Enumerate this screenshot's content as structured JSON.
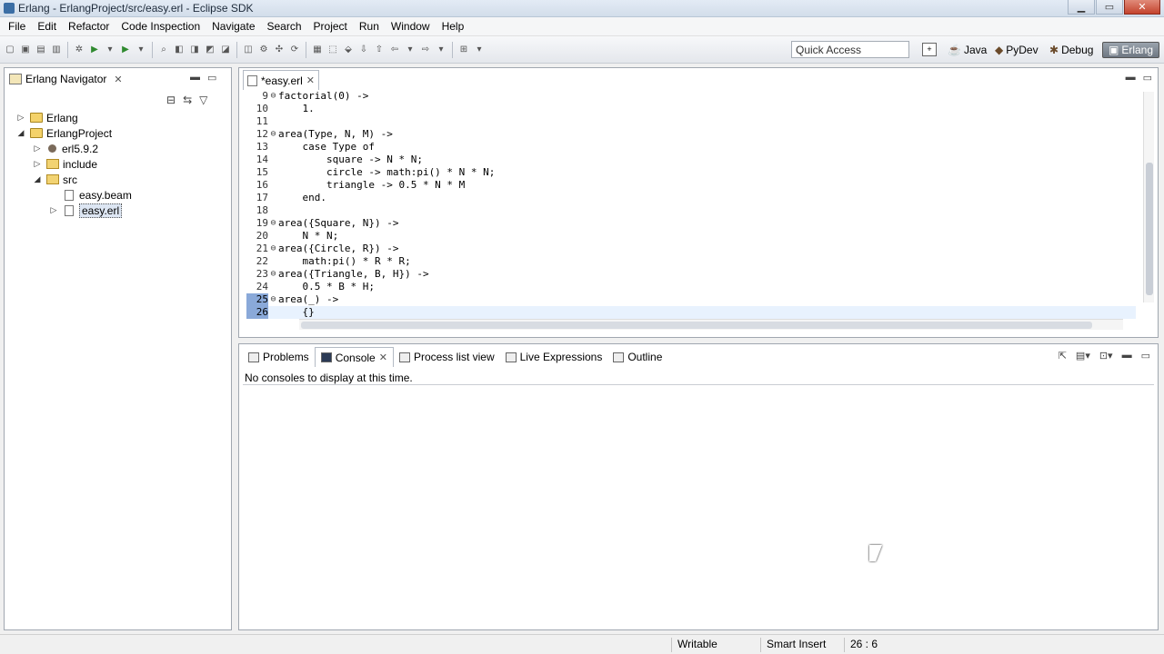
{
  "window": {
    "title": "Erlang - ErlangProject/src/easy.erl - Eclipse SDK"
  },
  "menu": [
    "File",
    "Edit",
    "Refactor",
    "Code Inspection",
    "Navigate",
    "Search",
    "Project",
    "Run",
    "Window",
    "Help"
  ],
  "toolbar": {
    "quick_access": "Quick Access",
    "perspectives": [
      "Java",
      "PyDev",
      "Debug",
      "Erlang"
    ],
    "active_perspective": "Erlang"
  },
  "navigator": {
    "title": "Erlang Navigator",
    "tree": [
      {
        "label": "Erlang",
        "arrow": "▷",
        "icon": "project-icon",
        "depth": 0
      },
      {
        "label": "ErlangProject",
        "arrow": "◢",
        "icon": "project-icon",
        "depth": 0
      },
      {
        "label": "erl5.9.2",
        "arrow": "▷",
        "icon": "library-icon",
        "depth": 1
      },
      {
        "label": "include",
        "arrow": "▷",
        "icon": "folder-icon",
        "depth": 1
      },
      {
        "label": "src",
        "arrow": "◢",
        "icon": "folder-icon",
        "depth": 1
      },
      {
        "label": "easy.beam",
        "arrow": "",
        "icon": "file-icon",
        "depth": 2
      },
      {
        "label": "easy.erl",
        "arrow": "▷",
        "icon": "file-icon",
        "depth": 2,
        "selected": true
      }
    ]
  },
  "editor": {
    "tab_label": "*easy.erl",
    "lines": [
      {
        "n": "9",
        "fold": "⊖",
        "text": "factorial(0) ->"
      },
      {
        "n": "10",
        "fold": "",
        "text": "    1."
      },
      {
        "n": "11",
        "fold": "",
        "text": ""
      },
      {
        "n": "12",
        "fold": "⊖",
        "text": "area(Type, N, M) ->"
      },
      {
        "n": "13",
        "fold": "",
        "text": "    case Type of"
      },
      {
        "n": "14",
        "fold": "",
        "text": "        square -> N * N;"
      },
      {
        "n": "15",
        "fold": "",
        "text": "        circle -> math:pi() * N * N;"
      },
      {
        "n": "16",
        "fold": "",
        "text": "        triangle -> 0.5 * N * M"
      },
      {
        "n": "17",
        "fold": "",
        "text": "    end."
      },
      {
        "n": "18",
        "fold": "",
        "text": ""
      },
      {
        "n": "19",
        "fold": "⊖",
        "text": "area({Square, N}) ->"
      },
      {
        "n": "20",
        "fold": "",
        "text": "    N * N;"
      },
      {
        "n": "21",
        "fold": "⊖",
        "text": "area({Circle, R}) ->"
      },
      {
        "n": "22",
        "fold": "",
        "text": "    math:pi() * R * R;"
      },
      {
        "n": "23",
        "fold": "⊖",
        "text": "area({Triangle, B, H}) ->"
      },
      {
        "n": "24",
        "fold": "",
        "text": "    0.5 * B * H;"
      },
      {
        "n": "25",
        "fold": "⊖",
        "text": "area(_) ->"
      },
      {
        "n": "26",
        "fold": "",
        "text": "    {}"
      }
    ]
  },
  "console_panel": {
    "tabs": [
      "Problems",
      "Console",
      "Process list view",
      "Live Expressions",
      "Outline"
    ],
    "active_tab": "Console",
    "message": "No consoles to display at this time."
  },
  "status": {
    "writable": "Writable",
    "insert_mode": "Smart Insert",
    "position": "26 : 6"
  }
}
